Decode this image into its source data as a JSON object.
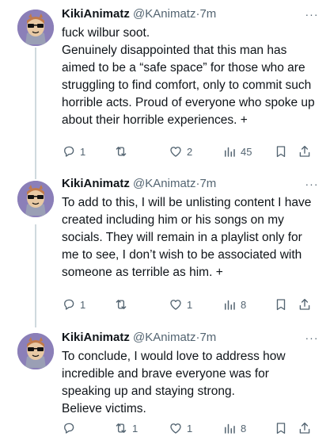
{
  "tweets": [
    {
      "display_name": "KikiAnimatz",
      "handle": "@KAnimatz",
      "separator": "·",
      "time": "7m",
      "more": "···",
      "lines": [
        "fuck wilbur soot.",
        "Genuinely disappointed that this man has aimed to be a “safe space” for those who are struggling to find comfort, only to commit such horrible acts. Proud of everyone who spoke up about their horrible experiences. +"
      ],
      "replies": "1",
      "retweets": "",
      "likes": "2",
      "views": "45",
      "icons": [
        "reply-icon",
        "retweet-icon",
        "like-icon",
        "views-icon",
        "bookmark-icon",
        "share-icon"
      ]
    },
    {
      "display_name": "KikiAnimatz",
      "handle": "@KAnimatz",
      "separator": "·",
      "time": "7m",
      "more": "···",
      "lines": [
        "To add to this, I will be unlisting content I have created including him or his songs on my socials. They will remain in a playlist only for me to see, I don’t wish to be associated with someone as terrible as him. +"
      ],
      "replies": "1",
      "retweets": "",
      "likes": "1",
      "views": "8",
      "icons": [
        "reply-icon",
        "retweet-icon",
        "like-icon",
        "views-icon",
        "bookmark-icon",
        "share-icon"
      ]
    },
    {
      "display_name": "KikiAnimatz",
      "handle": "@KAnimatz",
      "separator": "·",
      "time": "7m",
      "more": "···",
      "lines": [
        "To conclude, I would love to address how incredible and brave everyone was for speaking up and staying strong.",
        "Believe victims."
      ],
      "replies": "",
      "retweets": "1",
      "likes": "1",
      "views": "8",
      "icons": [
        "reply-icon",
        "retweet-icon",
        "like-icon",
        "views-icon",
        "bookmark-icon",
        "share-icon"
      ]
    }
  ],
  "colors": {
    "text": "#0f1419",
    "secondary": "#536471",
    "thread_line": "#cfd9de",
    "avatar_bg": "#8b7fb8"
  }
}
